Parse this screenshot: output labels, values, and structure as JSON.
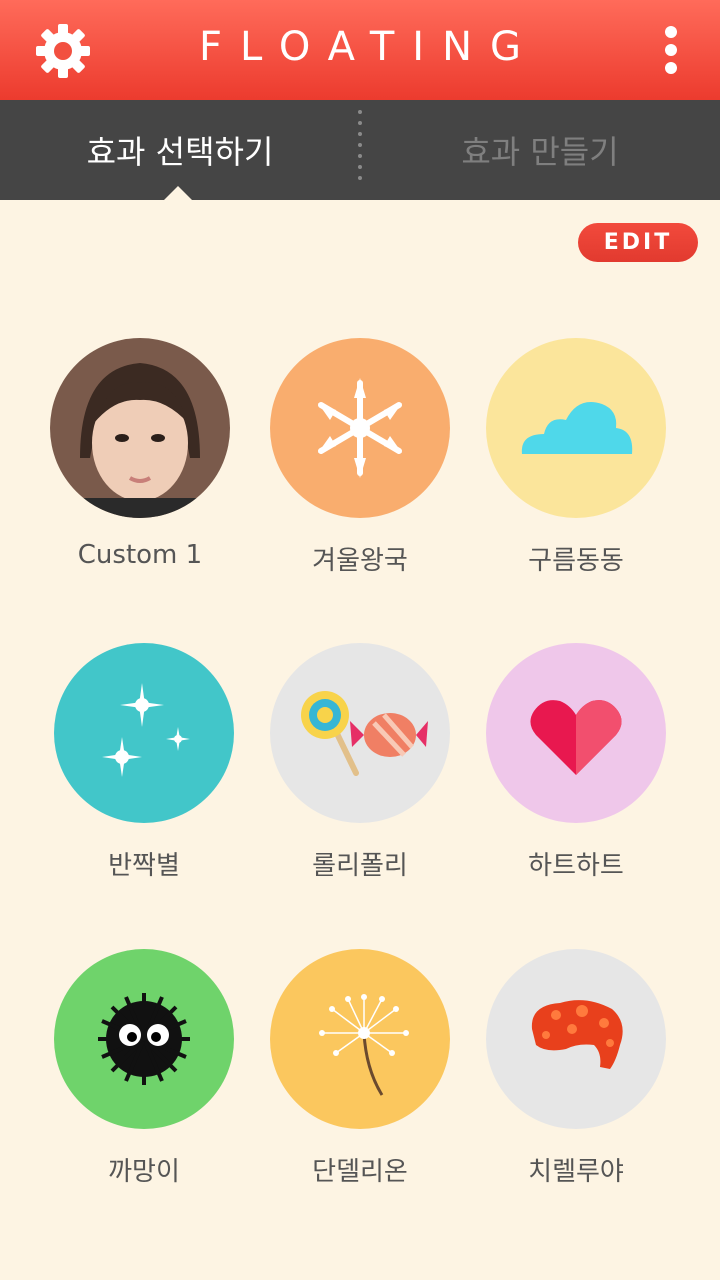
{
  "app": {
    "title": "FLOATING"
  },
  "tabs": {
    "select": "효과 선택하기",
    "create": "효과 만들기"
  },
  "edit_label": "EDIT",
  "effects": [
    {
      "label": "Custom 1",
      "color": "#7a5a4b"
    },
    {
      "label": "겨울왕국",
      "color": "#f9ad6e"
    },
    {
      "label": "구름동동",
      "color": "#fbe59b"
    },
    {
      "label": "반짝별",
      "color": "#42c6c9"
    },
    {
      "label": "롤리폴리",
      "color": "#e6e6e6"
    },
    {
      "label": "하트하트",
      "color": "#efc7ea"
    },
    {
      "label": "까망이",
      "color": "#6fd36b"
    },
    {
      "label": "단델리온",
      "color": "#fbc75e"
    },
    {
      "label": "치렐루야",
      "color": "#e6e6e6"
    }
  ]
}
